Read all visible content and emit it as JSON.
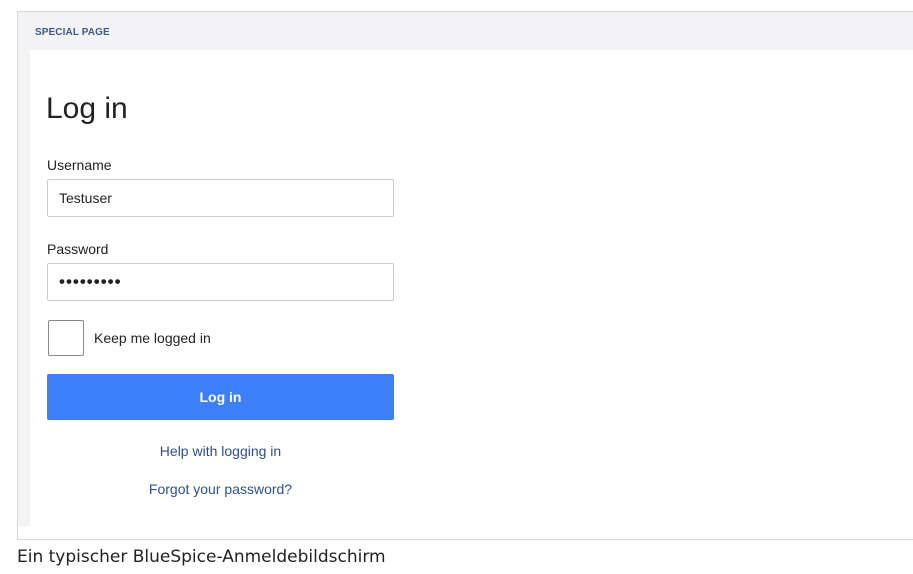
{
  "page": {
    "header_label": "SPECIAL PAGE",
    "title": "Log in"
  },
  "form": {
    "username_label": "Username",
    "username_value": "Testuser",
    "password_label": "Password",
    "password_value": "•••••••••",
    "keep_logged_label": "Keep me logged in",
    "keep_logged_checked": false,
    "submit_label": "Log in"
  },
  "links": {
    "help": "Help with logging in",
    "forgot": "Forgot your password?"
  },
  "caption": "Ein typischer BlueSpice-Anmeldebildschirm",
  "colors": {
    "accent": "#3d7ff7",
    "link": "#2f4f86",
    "header_band": "#f3f3f5"
  }
}
